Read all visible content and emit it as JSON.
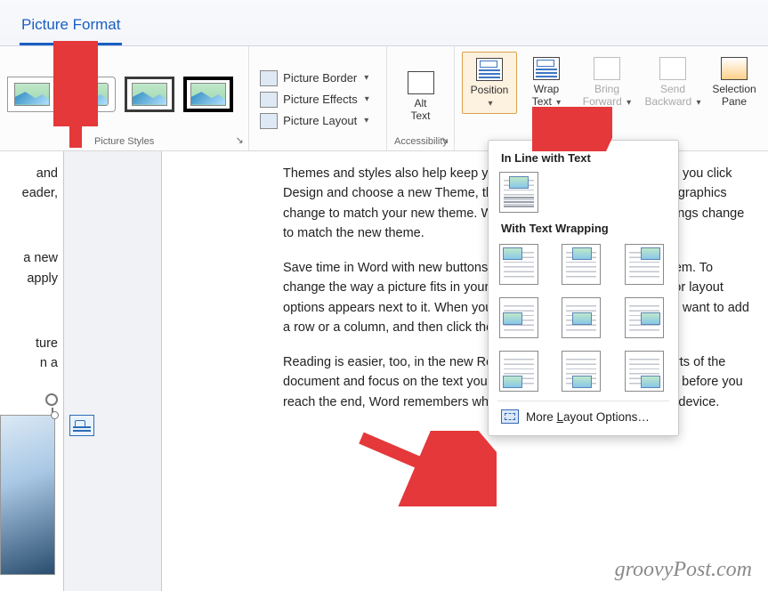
{
  "tab": {
    "label": "Picture Format"
  },
  "ribbon": {
    "groups": {
      "picture_styles": {
        "label": "Picture Styles"
      },
      "adjust": {
        "border": "Picture Border",
        "effects": "Picture Effects",
        "layout": "Picture Layout"
      },
      "alt_text": {
        "label": "Alt\nText",
        "group_label": "Accessibility"
      },
      "arrange": {
        "position": "Position",
        "wrap": "Wrap\nText",
        "bring_forward": "Bring\nForward",
        "send_backward": "Send\nBackward",
        "selection_pane": "Selection\nPane"
      }
    }
  },
  "dropdown": {
    "section_inline": "In Line with Text",
    "section_wrap": "With Text Wrapping",
    "more_options_pre": "More ",
    "more_options_u": "L",
    "more_options_post": "ayout Options…"
  },
  "document": {
    "left_fragments": [
      "and",
      "eader,",
      "",
      "a new",
      "apply",
      "",
      "ture",
      "n a"
    ],
    "para1": "Themes and styles also help keep your document coordinated. When you click Design and choose a new Theme, the pictures, charts, and SmartArt graphics change to match your new theme. When you apply styles, your headings change to match the new theme.",
    "para2": "Save time in Word with new buttons that show up where you need them. To change the way a picture fits in your document, click it and a button for layout options appears next to it. When you work on a table, click where you want to add a row or a column, and then click the plus sign.",
    "para3": "Reading is easier, too, in the new Reading view. You can collapse parts of the document and focus on the text you want. If you need to stop reading before you reach the end, Word remembers where you left off - even on another device."
  },
  "watermark": "groovyPost.com"
}
